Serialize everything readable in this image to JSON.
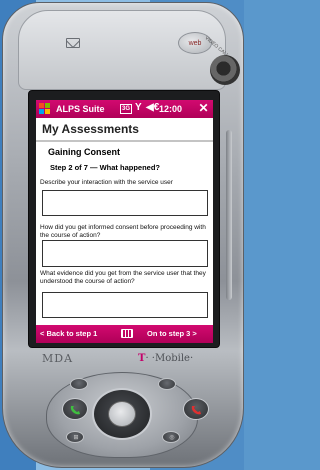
{
  "device": {
    "brand_left": "MDA",
    "brand_right_t": "T",
    "brand_right_rest": "· ·Mobile·",
    "web_button_label": "web",
    "video_call_label": "VIDEO CALL"
  },
  "titlebar": {
    "app_title": "ALPS Suite",
    "network_badge": "3G",
    "signal_glyph": "Y",
    "volume_glyph": "◀€",
    "time": "12:00",
    "close_glyph": "✕"
  },
  "page": {
    "title": "My Assessments",
    "section_heading": "Gaining Consent",
    "step_label": "Step 2 of 7 — What happened?"
  },
  "questions": [
    {
      "text": "Describe your interaction with the service user",
      "answer": ""
    },
    {
      "text": "How did you get informed consent before proceeding with the course of action?",
      "answer": ""
    },
    {
      "text": "What evidence did you get from the service user that they understood the course of action?",
      "answer": ""
    }
  ],
  "nav": {
    "back_label": "< Back to step 1",
    "next_label": "On to step 3 >"
  },
  "colors": {
    "accent": "#c8086a",
    "background": "#5a98cc"
  },
  "icons": {
    "windows": "windows-flag-icon",
    "signal": "antenna-icon",
    "volume": "speaker-icon",
    "keyboard": "keyboard-icon",
    "mail": "mail-icon",
    "call": "phone-icon",
    "end": "end-call-icon"
  }
}
